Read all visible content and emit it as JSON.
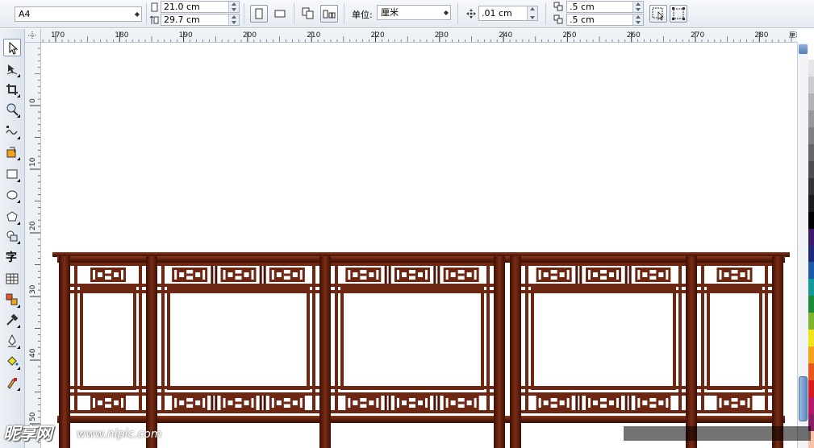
{
  "propbar": {
    "paper_size": "A4",
    "width_value": "21.0 cm",
    "height_value": "29.7 cm",
    "units_label": "单位:",
    "units_value": "厘米",
    "nudge_value": ".01 cm",
    "dup_x_value": ".5 cm",
    "dup_y_value": ".5 cm"
  },
  "ruler": {
    "h_labels": [
      "170",
      "180",
      "190",
      "200",
      "210",
      "220",
      "230",
      "240",
      "250",
      "260",
      "270",
      "280"
    ],
    "h_unit": "厘米",
    "v_labels": [
      "0",
      "10",
      "20",
      "30",
      "40",
      "50"
    ]
  },
  "tools": [
    {
      "name": "pick-tool-icon",
      "active": true
    },
    {
      "name": "shape-tool-icon"
    },
    {
      "name": "crop-tool-icon"
    },
    {
      "name": "zoom-tool-icon"
    },
    {
      "name": "freehand-tool-icon"
    },
    {
      "name": "smart-fill-tool-icon"
    },
    {
      "name": "rectangle-tool-icon"
    },
    {
      "name": "ellipse-tool-icon"
    },
    {
      "name": "polygon-tool-icon"
    },
    {
      "name": "basic-shapes-tool-icon"
    },
    {
      "name": "text-tool-icon",
      "glyph": "字"
    },
    {
      "name": "table-tool-icon"
    },
    {
      "name": "interactive-blend-tool-icon"
    },
    {
      "name": "eyedropper-tool-icon"
    },
    {
      "name": "outline-pen-tool-icon"
    },
    {
      "name": "fill-tool-icon"
    },
    {
      "name": "interactive-fill-tool-icon"
    }
  ],
  "palette": [
    "#ffffff",
    "#e5e5e5",
    "#cccccc",
    "#b2b2b2",
    "#999999",
    "#808080",
    "#666666",
    "#4d4d4d",
    "#333333",
    "#1a1a1a",
    "#000000",
    "#3b1a6b",
    "#1e2a78",
    "#1c5aa8",
    "#149a9a",
    "#1d8a3a",
    "#7fb431",
    "#f0e41a",
    "#f4a31b",
    "#e8581e",
    "#d7191c",
    "#b5176a",
    "#8b1f63",
    "#f7c3a8"
  ],
  "watermark": {
    "logo_text": "昵享网",
    "url": "www.nipic.com",
    "id_text": ""
  },
  "colors": {
    "wood_dark": "#4a1408",
    "wood_mid": "#6e2713",
    "wood_light": "#8a3a1c"
  }
}
